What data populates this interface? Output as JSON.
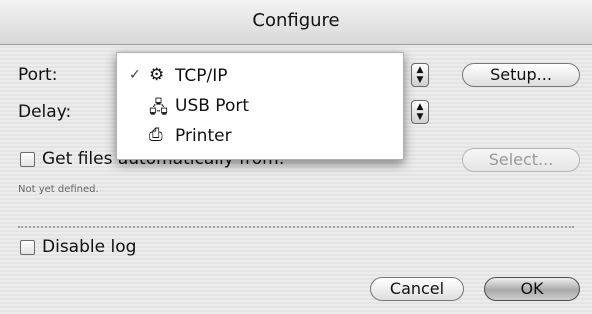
{
  "window": {
    "title": "Configure"
  },
  "fields": {
    "port_label": "Port:",
    "delay_label": "Delay:",
    "setup_button": "Setup...",
    "get_files_label": "Get files automatically from:",
    "select_button": "Select...",
    "not_defined_text": "Not yet defined.",
    "disable_log_label": "Disable log"
  },
  "popup_menu": {
    "items": [
      {
        "label": "TCP/IP",
        "icon": "tcpip-icon",
        "checked": true
      },
      {
        "label": "USB Port",
        "icon": "usb-icon",
        "checked": false
      },
      {
        "label": "Printer",
        "icon": "printer-icon",
        "checked": false
      }
    ],
    "check_mark": "✓"
  },
  "footer": {
    "cancel_button": "Cancel",
    "ok_button": "OK"
  }
}
